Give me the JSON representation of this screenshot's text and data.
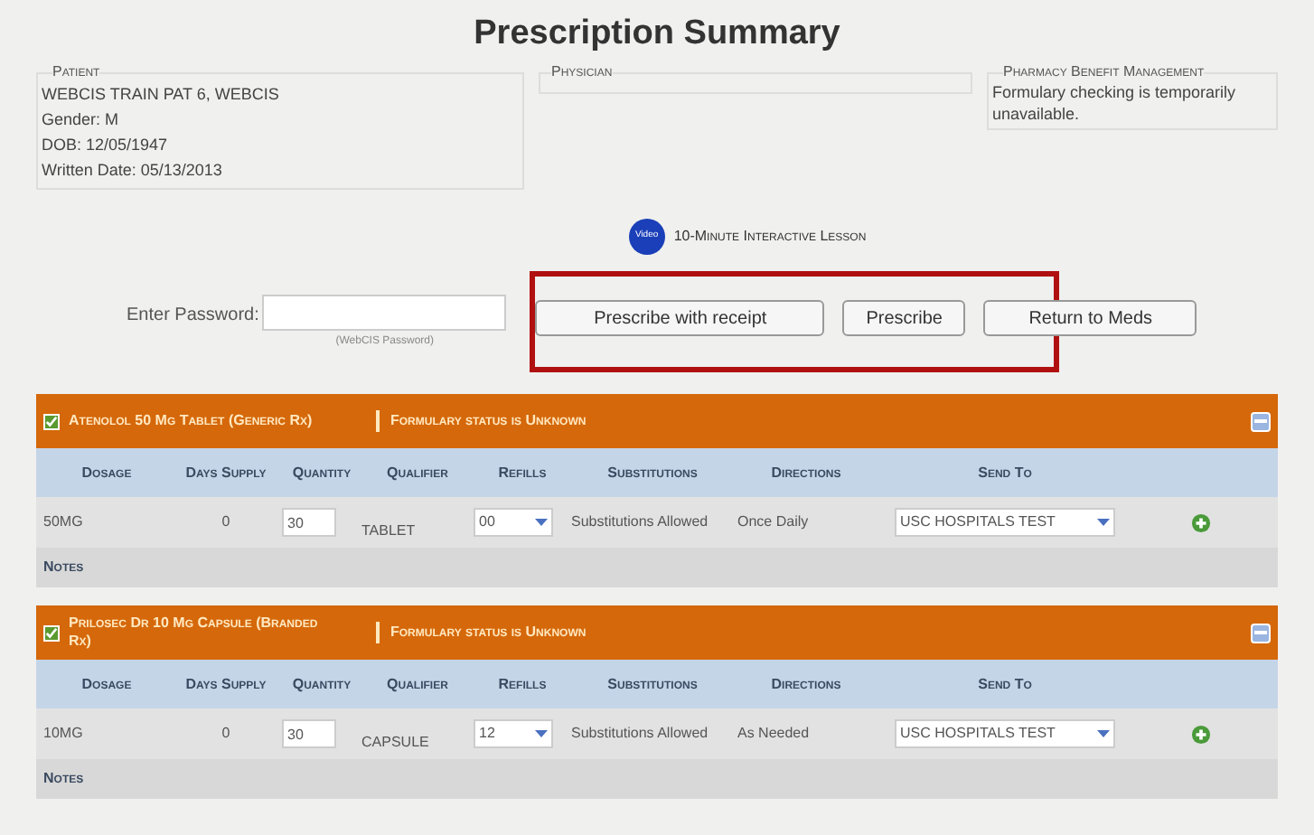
{
  "title": "Prescription Summary",
  "patient": {
    "heading": "Patient",
    "lines": [
      "WEBCIS TRAIN PAT 6, WEBCIS",
      "Gender: M",
      "DOB: 12/05/1947",
      "Written Date: 05/13/2013"
    ]
  },
  "physician": {
    "heading": "Physician"
  },
  "pbm": {
    "heading": "Pharmacy Benefit Management",
    "message": "Formulary checking is temporarily unavailable."
  },
  "lesson": {
    "badge": "Video",
    "label": "10-Minute Interactive Lesson"
  },
  "password": {
    "label": "Enter Password:",
    "hint": "(WebCIS Password)"
  },
  "buttons": [
    "Prescribe with receipt",
    "Prescribe",
    "Return to Meds"
  ],
  "meds": [
    {
      "columns": [
        "Dosage",
        "Days Supply",
        "Quantity",
        "Qualifier",
        "Refills",
        "Substitutions",
        "Directions",
        "Send To"
      ],
      "name": "Atenolol 50 Mg Tablet (Generic Rx)",
      "checked": true,
      "formulary": "Formulary status is Unknown",
      "dosage": "50MG",
      "days_supply": "0",
      "quantity": "30",
      "qualifier": "TABLET",
      "refills": "00",
      "substitutions": "Substitutions Allowed",
      "directions": "Once Daily",
      "send_to": "USC HOSPITALS TEST",
      "notes": "Notes"
    },
    {
      "columns": [
        "Dosage",
        "Days Supply",
        "Quantity",
        "Qualifier",
        "Refills",
        "Substitutions",
        "Directions",
        "Send To"
      ],
      "name": "Prilosec Dr 10 Mg Capsule (Branded Rx)",
      "checked": true,
      "formulary": "Formulary status is Unknown",
      "dosage": "10MG",
      "days_supply": "0",
      "quantity": "30",
      "qualifier": "CAPSULE",
      "refills": "12",
      "substitutions": "Substitutions Allowed",
      "directions": "As Needed",
      "send_to": "USC HOSPITALS TEST",
      "notes": "Notes"
    }
  ]
}
